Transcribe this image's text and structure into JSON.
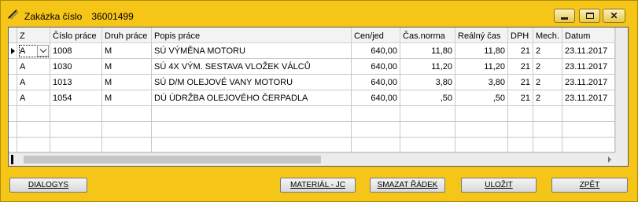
{
  "window": {
    "title": "Zakázka číslo",
    "order_number": "36001499"
  },
  "grid": {
    "columns": [
      "Z",
      "Číslo práce",
      "Druh práce",
      "Popis práce",
      "Cen/jed",
      "Čas.norma",
      "Reálný čas",
      "DPH",
      "Mech.",
      "Datum"
    ],
    "rows": [
      [
        "A",
        "1008",
        "M",
        "SÚ VÝMĚNA MOTORU",
        "640,00",
        "11,80",
        "11,80",
        "21",
        "2",
        "23.11.2017"
      ],
      [
        "A",
        "1030",
        "M",
        "SÚ 4X VÝM. SESTAVA VLOŽEK VÁLCŮ",
        "640,00",
        "11,20",
        "11,20",
        "21",
        "2",
        "23.11.2017"
      ],
      [
        "A",
        "1013",
        "M",
        "SÚ D/M OLEJOVÉ VANY MOTORU",
        "640,00",
        "3,80",
        "3,80",
        "21",
        "2",
        "23.11.2017"
      ],
      [
        "A",
        "1054",
        "M",
        "DÚ ÚDRŽBA OLEJOVÉHO ČERPADLA",
        "640,00",
        ",50",
        ",50",
        "21",
        "2",
        "23.11.2017"
      ]
    ]
  },
  "buttons": {
    "dialogs": "DIALOGYS",
    "material": "MATERIÁL - JC",
    "delete_row": "SMAZAT ŘÁDEK",
    "save": "ULOŽIT",
    "back": "ZPĚT"
  },
  "icons": {
    "app": "pencil-icon",
    "minimize": "minimize-icon",
    "maximize": "maximize-icon",
    "close": "close-icon"
  }
}
